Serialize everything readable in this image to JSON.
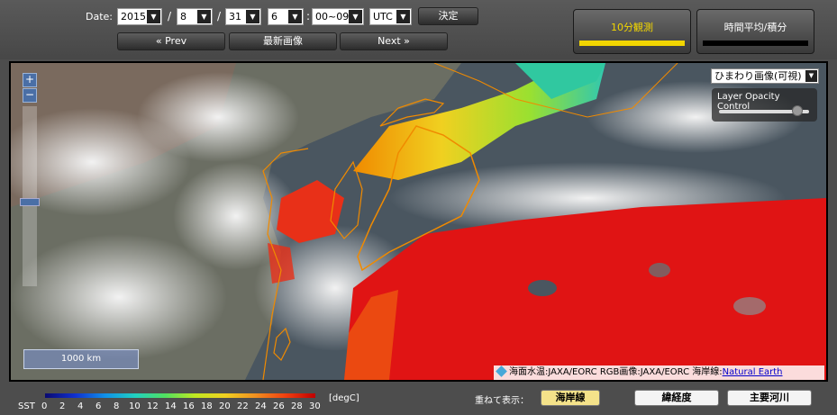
{
  "date": {
    "label": "Date:",
    "year": "2015",
    "month": "8",
    "day": "31",
    "hour": "6",
    "minute": "00~09",
    "timezone": "UTC",
    "separator": "/",
    "colon": ":"
  },
  "buttons": {
    "submit": "決定",
    "prev": "« Prev",
    "latest": "最新画像",
    "next": "Next »"
  },
  "tabs": [
    {
      "label": "10分観測",
      "active": true,
      "bar_color": "#f2d600"
    },
    {
      "label": "時間平均/積分",
      "active": false,
      "bar_color": "#000000"
    }
  ],
  "map": {
    "zoom_in": "+",
    "zoom_out": "−",
    "scale_label": "1000 km",
    "layer_select": "ひまわり画像(可視)",
    "opacity_title": "Layer Opacity Control",
    "opacity_value": 0.9,
    "credit_text": "海面水温:JAXA/EORC RGB画像:JAXA/EORC 海岸線:",
    "credit_link": "Natural Earth"
  },
  "legend": {
    "label": "SST",
    "ticks": [
      "0",
      "2",
      "4",
      "6",
      "8",
      "10",
      "12",
      "14",
      "16",
      "18",
      "20",
      "22",
      "24",
      "26",
      "28",
      "30"
    ],
    "unit": "[degC]"
  },
  "overlay": {
    "label": "重ねて表示：",
    "buttons": [
      {
        "label": "海岸線",
        "active": true
      },
      {
        "label": "緯経度",
        "active": false
      },
      {
        "label": "主要河川",
        "active": false
      }
    ]
  },
  "colors": {
    "background": "#4d4d4d",
    "active_tab_bar": "#f2d600",
    "sst_hot": "#e01010",
    "sst_warm": "#f0a000",
    "sst_cool": "#40d080",
    "coastline": "#f08a00"
  }
}
